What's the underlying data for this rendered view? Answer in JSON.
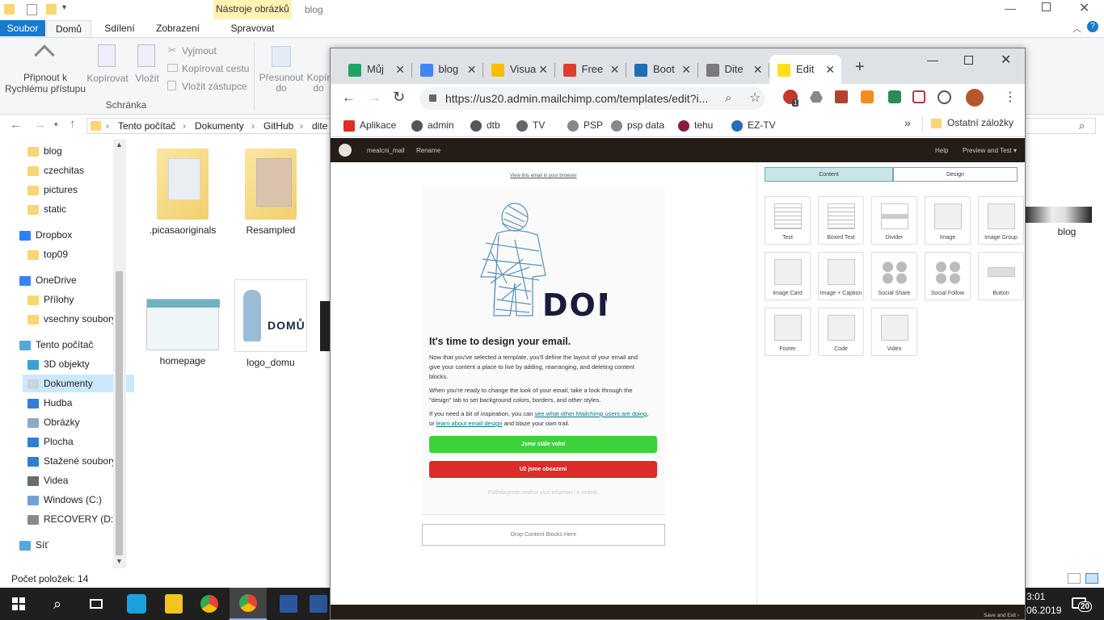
{
  "explorer": {
    "ribbon_context": "Nástroje obrázků",
    "window_title": "blog",
    "tabs": [
      "Soubor",
      "Domů",
      "Sdílení",
      "Zobrazení",
      "Spravovat"
    ],
    "ribbon": {
      "pin": "Připnout k Rychlému přístupu",
      "copy": "Kopírovat",
      "paste": "Vložit",
      "cut": "Vyjmout",
      "copy_path": "Kopírovat cestu",
      "paste_shortcut": "Vložit zástupce",
      "group_clipboard": "Schránka",
      "move_to": "Přesunout do",
      "copy_to": "Kopír do"
    },
    "breadcrumb": [
      "Tento počítač",
      "Dokumenty",
      "GitHub",
      "dite"
    ],
    "sidebar": [
      {
        "label": "blog",
        "indent": 34,
        "color": "#f7d774"
      },
      {
        "label": "czechitas",
        "indent": 34,
        "color": "#f7d774"
      },
      {
        "label": "pictures",
        "indent": 34,
        "color": "#f7d774"
      },
      {
        "label": "static",
        "indent": 34,
        "color": "#f7d774"
      },
      {
        "label": "Dropbox",
        "indent": 24,
        "color": "#2d7ff9"
      },
      {
        "label": "top09",
        "indent": 34,
        "color": "#f7d774"
      },
      {
        "label": "OneDrive",
        "indent": 24,
        "color": "#3b82f6"
      },
      {
        "label": "Přílohy",
        "indent": 34,
        "color": "#f7d774"
      },
      {
        "label": "vsechny soubory",
        "indent": 34,
        "color": "#f7d774"
      },
      {
        "label": "Tento počítač",
        "indent": 24,
        "color": "#58a6dc"
      },
      {
        "label": "3D objekty",
        "indent": 34,
        "color": "#39a0d9"
      },
      {
        "label": "Dokumenty",
        "indent": 34,
        "color": "#c9d4de"
      },
      {
        "label": "Hudba",
        "indent": 34,
        "color": "#2f7fd6"
      },
      {
        "label": "Obrázky",
        "indent": 34,
        "color": "#8fa9c7"
      },
      {
        "label": "Plocha",
        "indent": 34,
        "color": "#2f7fd6"
      },
      {
        "label": "Stažené soubory",
        "indent": 34,
        "color": "#2f7fd6"
      },
      {
        "label": "Videa",
        "indent": 34,
        "color": "#6b6b6b"
      },
      {
        "label": "Windows (C:)",
        "indent": 34,
        "color": "#6fa5d6"
      },
      {
        "label": "RECOVERY (D:)",
        "indent": 34,
        "color": "#8a8a8a"
      },
      {
        "label": "Síť",
        "indent": 24,
        "color": "#58a6dc"
      }
    ],
    "files": [
      ".picasaoriginals",
      "Resampled",
      "homepage",
      "logo_domu",
      "blog"
    ],
    "status": "Počet položek: 14"
  },
  "chrome": {
    "tabs": [
      {
        "label": "Můj",
        "color": "#1fa463"
      },
      {
        "label": "blog",
        "color": "#4285f4"
      },
      {
        "label": "Visua",
        "color": "#fbbc05"
      },
      {
        "label": "Free",
        "color": "#e03c31"
      },
      {
        "label": "Boot",
        "color": "#1f6fb5"
      },
      {
        "label": "Dite",
        "color": "#7a7a7a"
      },
      {
        "label": "Edit",
        "color": "#ffe01b"
      }
    ],
    "url": "https://us20.admin.mailchimp.com/templates/edit?i...",
    "bookmarks": [
      {
        "label": "Aplikace",
        "color": "#d93025"
      },
      {
        "label": "admin",
        "color": "#555"
      },
      {
        "label": "dtb",
        "color": "#555"
      },
      {
        "label": "TV",
        "color": "#666"
      },
      {
        "label": "PSP",
        "color": "#888"
      },
      {
        "label": "psp data",
        "color": "#888"
      },
      {
        "label": "tehu",
        "color": "#8b1a3a"
      },
      {
        "label": "EZ-TV",
        "color": "#2a6bb8"
      }
    ],
    "other_bookmarks": "Ostatní záložky",
    "more": "»",
    "avatar_color": "#b5562e",
    "badge": "1"
  },
  "mailchimp": {
    "left_menu": [
      "mealcni_mail",
      "Rename"
    ],
    "right_menu": [
      "Help",
      "Preview and Test"
    ],
    "view_in_browser": "View this email in your browser",
    "logo_text": "DOMŮ",
    "heading": "It's time to design your email.",
    "p1": "Now that you've selected a template, you'll define the layout of your email and give your content a place to live by adding, rearranging, and deleting content blocks.",
    "p2": "When you're ready to change the look of your email, take a look through the \"design\" tab to set background colors, borders, and other styles.",
    "p3_a": "If you need a bit of inspiration, you can ",
    "p3_link1": "see what other Mailchimp users are doing",
    "p3_b": ", or ",
    "p3_link2": "learn about email design",
    "p3_c": " and blaze your own trail.",
    "btn_green": "Jsme stále volní",
    "btn_red": "Už jsme obsazeni",
    "faded": "Potřebujeme změnit více informací o rodině.",
    "drop_zone": "Drop Content Blocks Here",
    "panel_tabs": [
      "Content",
      "Design"
    ],
    "blocks": [
      "Text",
      "Boxed Text",
      "Divider",
      "Image",
      "Image Group",
      "Image Card",
      "Image + Caption",
      "Social Share",
      "Social Follow",
      "Button",
      "Footer",
      "Code",
      "Video"
    ],
    "footer": "Save and Exit"
  },
  "taskbar": {
    "time": "3:01",
    "date": "06.2019",
    "notif_count": "20"
  }
}
